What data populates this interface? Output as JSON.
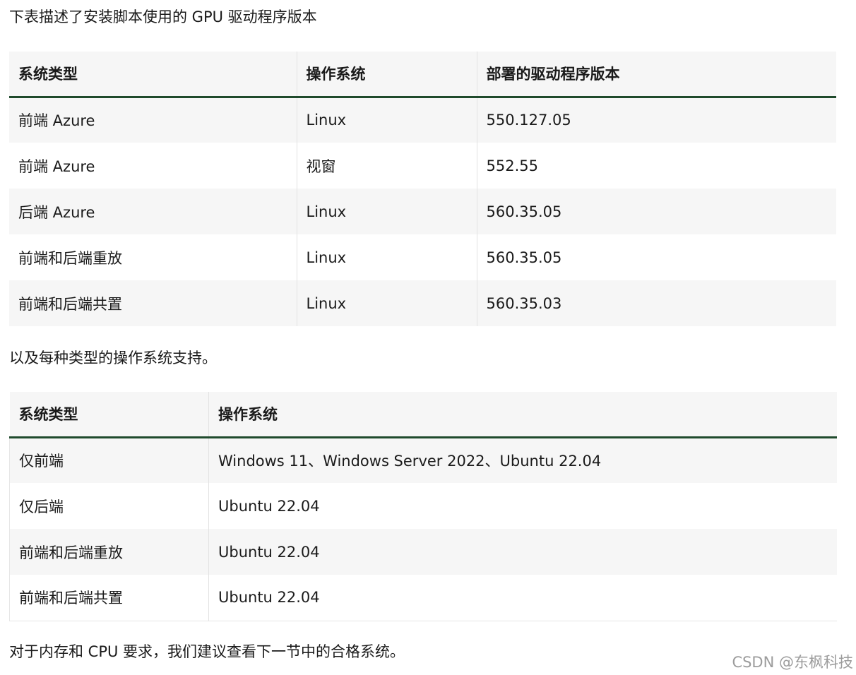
{
  "intro_text": "下表描述了安装脚本使用的 GPU 驱动程序版本",
  "driver_table": {
    "headers": [
      "系统类型",
      "操作系统",
      "部署的驱动程序版本"
    ],
    "rows": [
      [
        "前端 Azure",
        "Linux",
        "550.127.05"
      ],
      [
        "前端 Azure",
        "视窗",
        "552.55"
      ],
      [
        "后端 Azure",
        "Linux",
        "560.35.05"
      ],
      [
        "前端和后端重放",
        "Linux",
        "560.35.05"
      ],
      [
        "前端和后端共置",
        "Linux",
        "560.35.03"
      ]
    ]
  },
  "os_intro_text": "以及每种类型的操作系统支持。",
  "os_table": {
    "headers": [
      "系统类型",
      "操作系统"
    ],
    "rows": [
      [
        "仅前端",
        "Windows 11、Windows Server 2022、Ubuntu 22.04"
      ],
      [
        "仅后端",
        "Ubuntu 22.04"
      ],
      [
        "前端和后端重放",
        "Ubuntu 22.04"
      ],
      [
        "前端和后端共置",
        "Ubuntu 22.04"
      ]
    ]
  },
  "footer_text": "对于内存和 CPU 要求，我们建议查看下一节中的合格系统。",
  "watermark": "CSDN @东枫科技"
}
